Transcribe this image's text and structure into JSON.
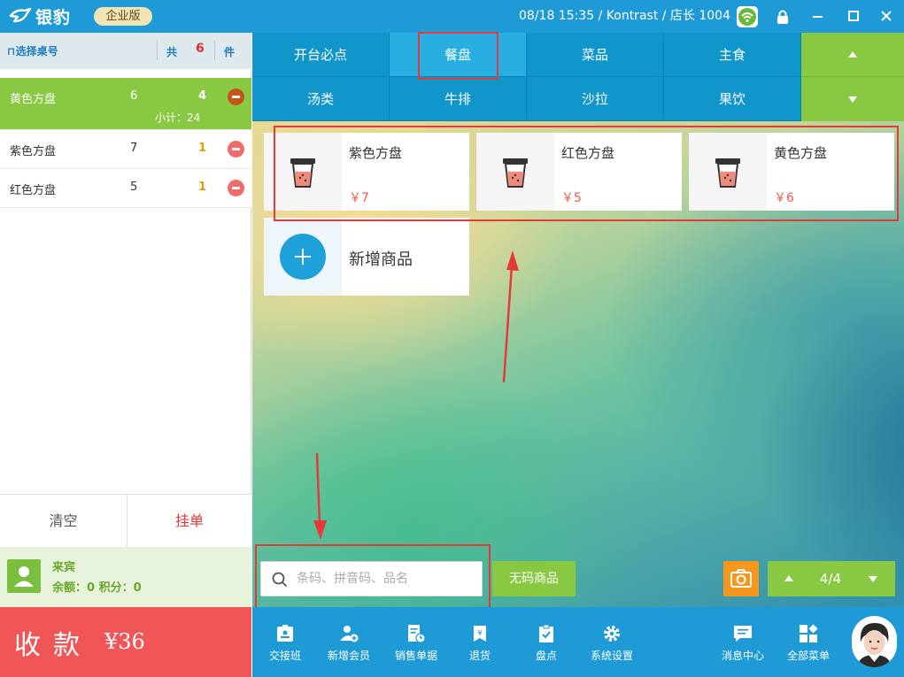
{
  "topbar": {
    "brand": "银豹",
    "edition": "企业版",
    "status": "08/18 15:35 / Kontrast / 店长 1004"
  },
  "order": {
    "table_label": "选择桌号",
    "total_prefix": "共",
    "total_count": "6",
    "total_suffix": "件",
    "items": [
      {
        "name": "黄色方盘",
        "price": "6",
        "qty": "4",
        "subtotal": "小计：24"
      },
      {
        "name": "紫色方盘",
        "price": "7",
        "qty": "1"
      },
      {
        "name": "红色方盘",
        "price": "5",
        "qty": "1"
      }
    ],
    "clear_label": "清空",
    "hang_label": "挂单"
  },
  "member": {
    "name": "来宾",
    "balance": "余额：0  积分：0"
  },
  "pay": {
    "label": "收款",
    "amount": "¥36"
  },
  "categories": {
    "row1": [
      "开台必点",
      "餐盘",
      "菜品",
      "主食"
    ],
    "row2": [
      "汤类",
      "牛排",
      "沙拉",
      "果饮"
    ],
    "selected": "餐盘"
  },
  "products": [
    {
      "name": "紫色方盘",
      "price": "￥7"
    },
    {
      "name": "红色方盘",
      "price": "￥5"
    },
    {
      "name": "黄色方盘",
      "price": "￥6"
    }
  ],
  "add_product": "新增商品",
  "search": {
    "placeholder": "条码、拼音码、品名"
  },
  "nocode_label": "无码商品",
  "pagination": "4/4",
  "toolbar": {
    "items": [
      "交接班",
      "新增会员",
      "销售单据",
      "退货",
      "盘点",
      "系统设置"
    ],
    "right": [
      "消息中心",
      "全部菜单"
    ]
  },
  "colors": {
    "brand_blue": "#1e9ad6",
    "green": "#88c842",
    "pay_red": "#f05656",
    "highlight_red": "#e53a3a",
    "orange": "#f5961d"
  }
}
